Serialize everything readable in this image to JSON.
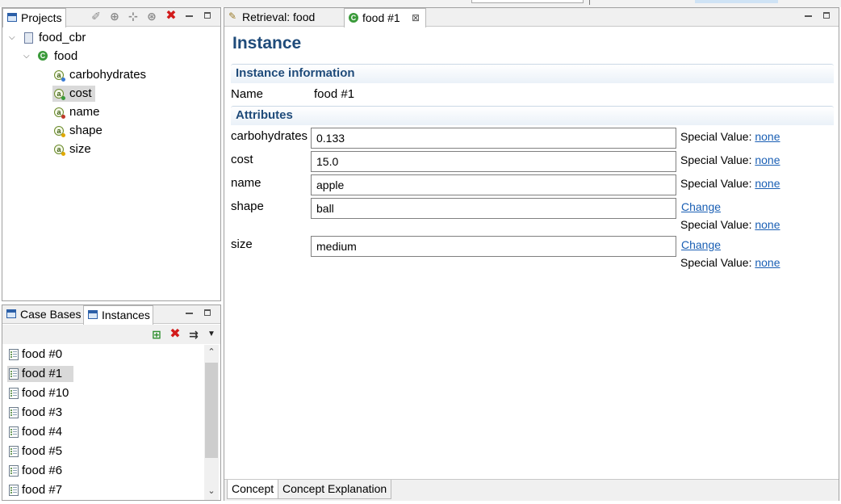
{
  "projects_view": {
    "tab_label": "Projects",
    "tree": {
      "project": "food_cbr",
      "concept": "food",
      "attributes": [
        "carbohydrates",
        "cost",
        "name",
        "shape",
        "size"
      ],
      "selected_attribute": "cost"
    }
  },
  "bottom_left_view": {
    "tabs": [
      "Case Bases",
      "Instances"
    ],
    "active_tab": "Instances",
    "instances": [
      "food #0",
      "food #1",
      "food #10",
      "food #3",
      "food #4",
      "food #5",
      "food #6",
      "food #7"
    ],
    "selected_instance": "food #1"
  },
  "editor": {
    "tabs": [
      {
        "label": "Retrieval: food"
      },
      {
        "label": "food #1",
        "active": true
      }
    ],
    "title": "Instance",
    "instance_info": {
      "header": "Instance information",
      "name_label": "Name",
      "name_value": "food #1"
    },
    "attributes": {
      "header": "Attributes",
      "special_value_label": "Special Value:",
      "change_label": "Change",
      "rows": [
        {
          "label": "carbohydrates",
          "value": "0.133",
          "special": "none",
          "change": false
        },
        {
          "label": "cost",
          "value": "15.0",
          "special": "none",
          "change": false
        },
        {
          "label": "name",
          "value": "apple",
          "special": "none",
          "change": false
        },
        {
          "label": "shape",
          "value": "ball",
          "special": "none",
          "change": true
        },
        {
          "label": "size",
          "value": "medium",
          "special": "none",
          "change": true
        }
      ]
    },
    "bottom_tabs": [
      "Concept",
      "Concept Explanation"
    ],
    "active_bottom_tab": "Concept"
  },
  "icons": {
    "projects_toolbar": [
      "pin-icon",
      "new-concept-icon",
      "new-attribute-icon",
      "new-instance-icon",
      "delete-icon"
    ],
    "instances_toolbar": [
      "add-instance-icon",
      "delete-icon",
      "sort-icon",
      "view-menu-icon"
    ]
  },
  "colors": {
    "header_text": "#1f4b7a",
    "link": "#1a5fb4",
    "delete_red": "#d21b1b"
  }
}
